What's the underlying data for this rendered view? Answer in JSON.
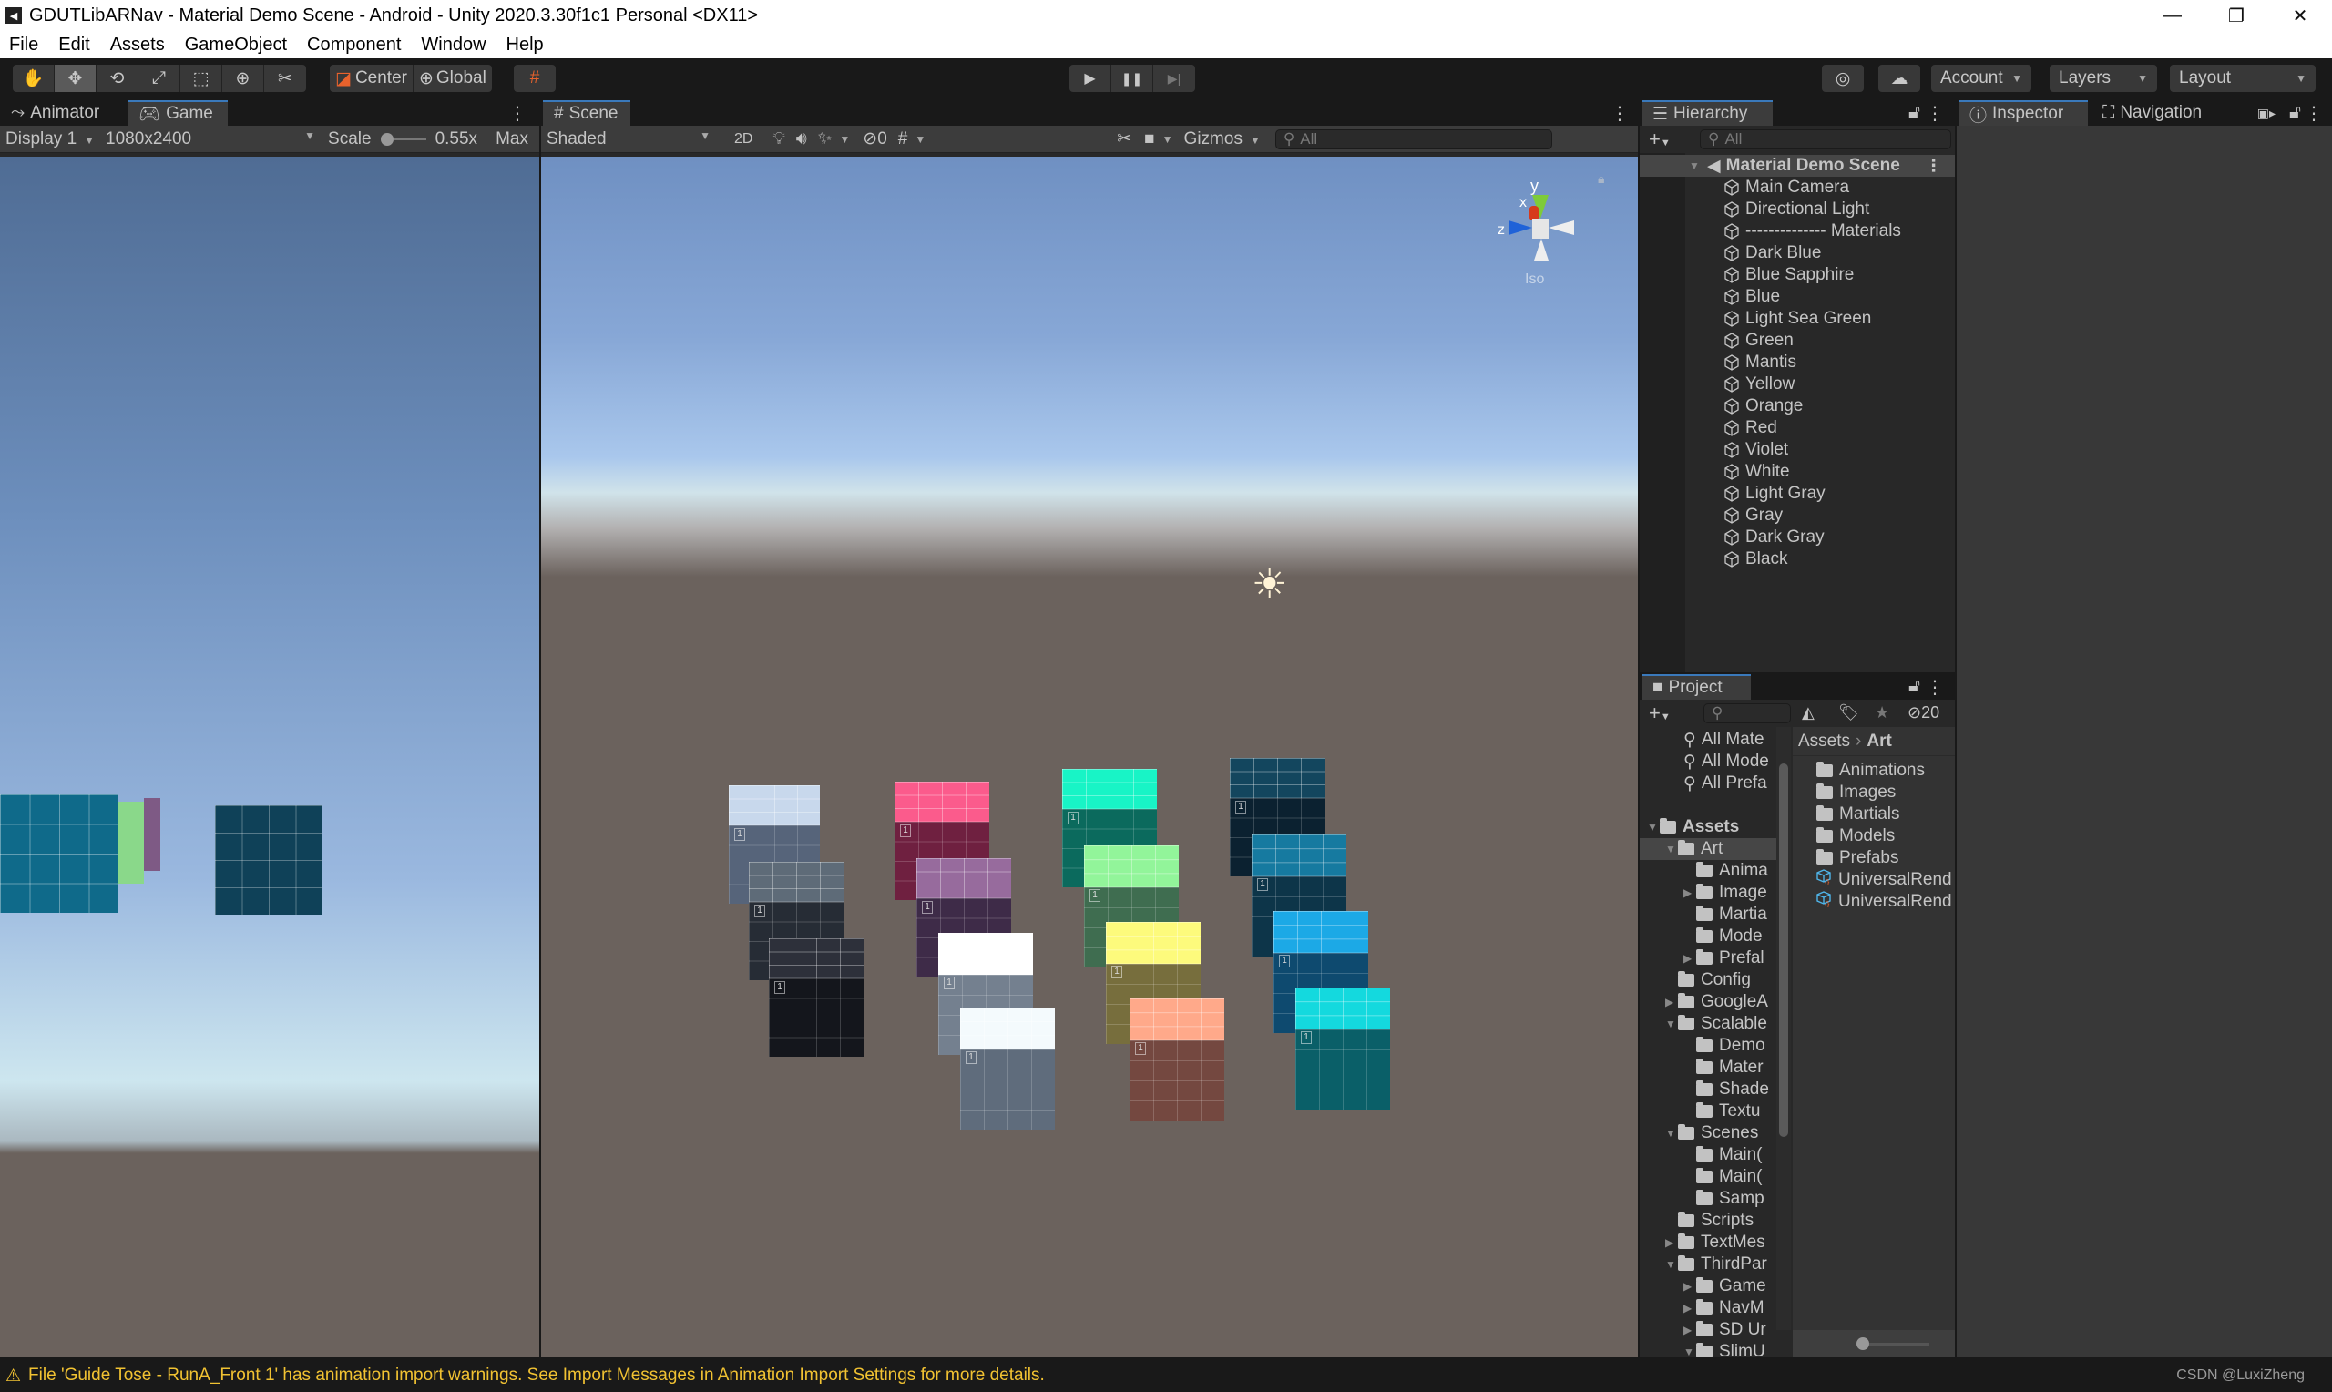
{
  "window": {
    "title": "GDUTLibARNav - Material Demo Scene - Android - Unity 2020.3.30f1c1 Personal <DX11>",
    "minimize": "—",
    "maximize": "❐",
    "close": "✕"
  },
  "menu": [
    "File",
    "Edit",
    "Assets",
    "GameObject",
    "Component",
    "Window",
    "Help"
  ],
  "toolbar": {
    "tools": [
      "hand-tool",
      "move-tool",
      "rotate-tool",
      "scale-tool",
      "rect-tool",
      "transform-tool",
      "custom-tool"
    ],
    "tool_glyphs": [
      "✋",
      "✥",
      "⟲",
      "⤢",
      "⬚",
      "⊕",
      "✂"
    ],
    "pivot": "Center",
    "space": "Global",
    "snap_glyph": "#",
    "play": "▶",
    "pause": "❚❚",
    "step": "▶|",
    "collab_glyph": "◎",
    "cloud_glyph": "☁",
    "account": "Account",
    "layers": "Layers",
    "layout": "Layout"
  },
  "game_panel": {
    "tabs": [
      "Animator",
      "Game"
    ],
    "display": "Display 1",
    "resolution": "1080x2400",
    "scale_label": "Scale",
    "scale_value": "0.55x",
    "max_label": "Max"
  },
  "scene_panel": {
    "tab": "Scene",
    "draw_mode": "Shaded",
    "mode_2d": "2D",
    "hidden_count": "0",
    "gizmos": "Gizmos",
    "search_placeholder": "All",
    "gizmo": {
      "x": "x",
      "y": "y",
      "z": "z",
      "projection": "Iso"
    }
  },
  "cubes": [
    {
      "name": "Light Gray",
      "top": "#c8d8ec",
      "side": "#56647a"
    },
    {
      "name": "Gray",
      "top": "#5e6b78",
      "side": "#262c35"
    },
    {
      "name": "Black",
      "top": "#2d303a",
      "side": "#14161c"
    },
    {
      "name": "Red",
      "top": "#fb5b8c",
      "side": "#6f2040"
    },
    {
      "name": "Violet",
      "top": "#976b9d",
      "side": "#3e2b48"
    },
    {
      "name": "White",
      "top": "#ffffff",
      "side": "#74808f"
    },
    {
      "name": "Dark Gray",
      "top": "#f4fafd",
      "side": "#5f6c7c"
    },
    {
      "name": "Light Sea Green",
      "top": "#18f4c6",
      "side": "#0b6a5d"
    },
    {
      "name": "Mantis",
      "top": "#92f59a",
      "side": "#3f6d50"
    },
    {
      "name": "Yellow",
      "top": "#fdfa7c",
      "side": "#776e3d"
    },
    {
      "name": "Orange",
      "top": "#ffa98a",
      "side": "#744840"
    },
    {
      "name": "Dark Blue",
      "top": "#13465e",
      "side": "#0b2130"
    },
    {
      "name": "Blue Sapphire",
      "top": "#167aa0",
      "side": "#0d3549"
    },
    {
      "name": "Blue",
      "top": "#1ca9e6",
      "side": "#0e4a6f"
    },
    {
      "name": "Green",
      "top": "#14d9de",
      "side": "#0a5f68"
    }
  ],
  "hierarchy": {
    "tab": "Hierarchy",
    "search_placeholder": "All",
    "scene": "Material Demo Scene",
    "items": [
      "Main Camera",
      "Directional Light",
      "-------------- Materials",
      "Dark Blue",
      "Blue Sapphire",
      "Blue",
      "Light Sea Green",
      "Green",
      "Mantis",
      "Yellow",
      "Orange",
      "Red",
      "Violet",
      "White",
      "Light Gray",
      "Gray",
      "Dark Gray",
      "Black"
    ]
  },
  "inspector": {
    "tabs": [
      "Inspector",
      "Navigation"
    ]
  },
  "project": {
    "tab": "Project",
    "hidden_count": "20",
    "favorites": [
      "All Mate",
      "All Mode",
      "All Prefa"
    ],
    "tree": [
      {
        "label": "Assets",
        "depth": 0,
        "arrow": "▼",
        "bold": true,
        "open": true
      },
      {
        "label": "Art",
        "depth": 1,
        "arrow": "▼",
        "open": true,
        "selected": true
      },
      {
        "label": "Anima",
        "depth": 2,
        "arrow": ""
      },
      {
        "label": "Image",
        "depth": 2,
        "arrow": "▶"
      },
      {
        "label": "Martia",
        "depth": 2,
        "arrow": ""
      },
      {
        "label": "Mode",
        "depth": 2,
        "arrow": ""
      },
      {
        "label": "Prefal",
        "depth": 2,
        "arrow": "▶"
      },
      {
        "label": "Config",
        "depth": 1,
        "arrow": ""
      },
      {
        "label": "GoogleA",
        "depth": 1,
        "arrow": "▶"
      },
      {
        "label": "Scalable",
        "depth": 1,
        "arrow": "▼",
        "open": true
      },
      {
        "label": "Demo",
        "depth": 2,
        "arrow": ""
      },
      {
        "label": "Mater",
        "depth": 2,
        "arrow": ""
      },
      {
        "label": "Shade",
        "depth": 2,
        "arrow": ""
      },
      {
        "label": "Textu",
        "depth": 2,
        "arrow": ""
      },
      {
        "label": "Scenes",
        "depth": 1,
        "arrow": "▼",
        "open": true
      },
      {
        "label": "Main(",
        "depth": 2,
        "arrow": ""
      },
      {
        "label": "Main(",
        "depth": 2,
        "arrow": ""
      },
      {
        "label": "Samp",
        "depth": 2,
        "arrow": ""
      },
      {
        "label": "Scripts",
        "depth": 1,
        "arrow": ""
      },
      {
        "label": "TextMes",
        "depth": 1,
        "arrow": "▶"
      },
      {
        "label": "ThirdPar",
        "depth": 1,
        "arrow": "▼",
        "open": true
      },
      {
        "label": "Game",
        "depth": 2,
        "arrow": "▶"
      },
      {
        "label": "NavM",
        "depth": 2,
        "arrow": "▶"
      },
      {
        "label": "SD Ur",
        "depth": 2,
        "arrow": "▶"
      },
      {
        "label": "SlimU",
        "depth": 2,
        "arrow": "▼",
        "open": true
      }
    ],
    "breadcrumb": [
      "Assets",
      "Art"
    ],
    "files": [
      {
        "label": "Animations",
        "type": "folder"
      },
      {
        "label": "Images",
        "type": "folder"
      },
      {
        "label": "Martials",
        "type": "folder"
      },
      {
        "label": "Models",
        "type": "folder"
      },
      {
        "label": "Prefabs",
        "type": "folder"
      },
      {
        "label": "UniversalRend",
        "type": "asset"
      },
      {
        "label": "UniversalRend",
        "type": "asset"
      }
    ]
  },
  "status": {
    "icon": "⚠",
    "message": "File 'Guide Tose - RunA_Front 1' has animation import warnings. See Import Messages in Animation Import Settings for more details.",
    "watermark": "CSDN @LuxiZheng"
  }
}
